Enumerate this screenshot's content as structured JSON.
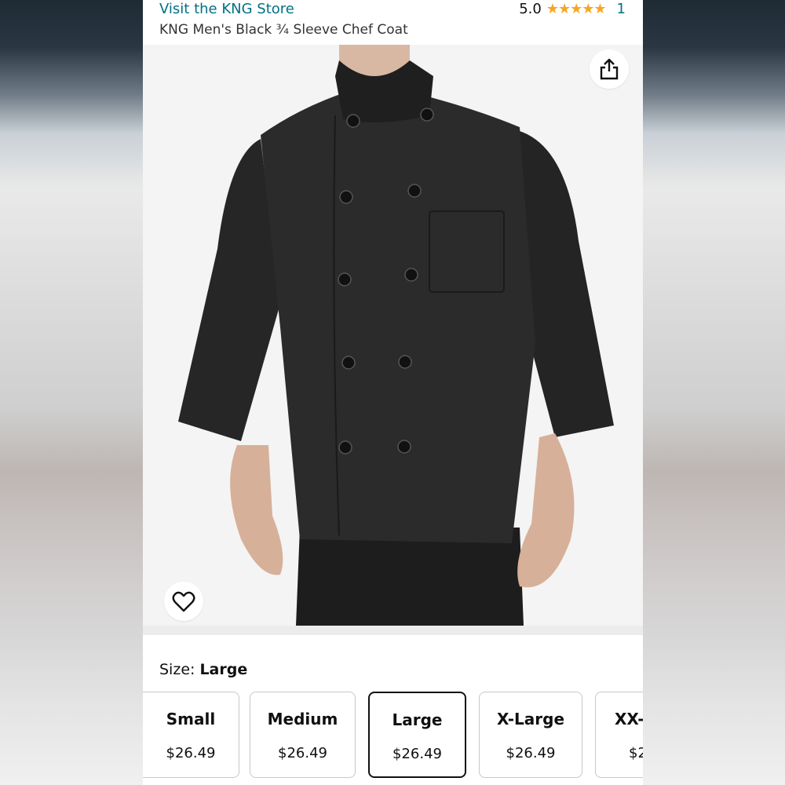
{
  "header": {
    "store_link": "Visit the KNG Store",
    "rating_value": "5.0",
    "stars": "★★★★★",
    "rating_count": "1",
    "product_title": "KNG Men's Black ¾ Sleeve Chef Coat"
  },
  "image": {
    "share_icon": "share-icon",
    "favorite_icon": "heart-icon"
  },
  "size": {
    "label_prefix": "Size: ",
    "selected": "Large",
    "options": [
      {
        "name": "Small",
        "price": "$26.49"
      },
      {
        "name": "Medium",
        "price": "$26.49"
      },
      {
        "name": "Large",
        "price": "$26.49"
      },
      {
        "name": "X-Large",
        "price": "$26.49"
      },
      {
        "name": "XX-",
        "price": "$2"
      }
    ]
  },
  "colors": {
    "link": "#007185",
    "star": "#f5a623",
    "selected_border": "#111111"
  }
}
